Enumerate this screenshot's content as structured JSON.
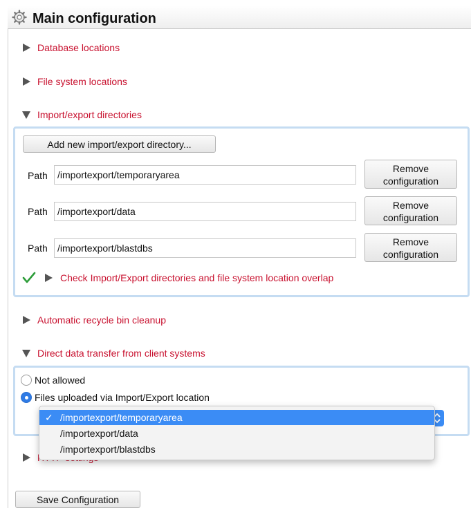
{
  "title": "Main configuration",
  "sections": {
    "database_locations": "Database locations",
    "file_system_locations": "File system locations",
    "import_export": "Import/export directories",
    "recycle_bin": "Automatic recycle bin cleanup",
    "direct_transfer": "Direct data transfer from client systems",
    "http_settings": "HTTP settings"
  },
  "import_export": {
    "add_button": "Add new import/export directory...",
    "path_label": "Path",
    "remove_label_1": "Remove",
    "remove_label_2": "configuration",
    "paths": [
      "/importexport/temporaryarea",
      "/importexport/data",
      "/importexport/blastdbs"
    ],
    "check_label": "Check Import/Export directories and file system location overlap"
  },
  "direct_transfer": {
    "option_not_allowed": "Not allowed",
    "option_files_uploaded": "Files uploaded via Import/Export location",
    "selected_option": "Files uploaded via Import/Export location",
    "dropdown_options": [
      "/importexport/temporaryarea",
      "/importexport/data",
      "/importexport/blastdbs"
    ],
    "dropdown_selected": "/importexport/temporaryarea"
  },
  "save_button": "Save Configuration",
  "colors": {
    "section_link": "#c8102e",
    "panel_border": "#c5dcf2",
    "selected_blue": "#3b8cf5",
    "check_green": "#2e9d3a"
  },
  "icons": {
    "title": "gear-icon",
    "collapsed": "triangle-right-icon",
    "expanded": "triangle-down-icon",
    "check": "checkmark-icon"
  }
}
